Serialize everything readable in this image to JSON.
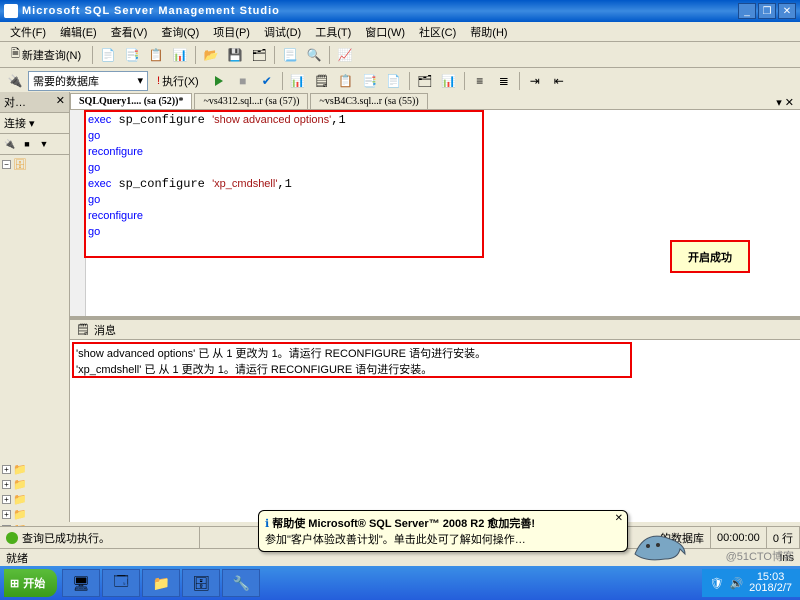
{
  "titlebar": {
    "title": "Microsoft SQL Server Management Studio"
  },
  "menubar": {
    "items": [
      "文件(F)",
      "编辑(E)",
      "查看(V)",
      "查询(Q)",
      "项目(P)",
      "调试(D)",
      "工具(T)",
      "窗口(W)",
      "社区(C)",
      "帮助(H)"
    ]
  },
  "toolbar1": {
    "new_query": "新建查询(N)"
  },
  "toolbar2": {
    "db_selected": "需要的数据库",
    "execute_label": "执行(X)"
  },
  "sidebar": {
    "title": "对…",
    "connect_label": "连接 ▾"
  },
  "tabs": [
    {
      "label": "SQLQuery1.... (sa (52))*",
      "active": true
    },
    {
      "label": "~vs4312.sql...r (sa (57))",
      "active": false
    },
    {
      "label": "~vsB4C3.sql...r (sa (55))",
      "active": false
    }
  ],
  "editor": {
    "lines": [
      {
        "t": "exec",
        "c": "blue"
      },
      {
        "t": " sp_configure ",
        "c": ""
      },
      {
        "t": "'show advanced options'",
        "c": "red"
      },
      {
        "t": ",1\n",
        "c": ""
      },
      {
        "t": "go\n",
        "c": "blue"
      },
      {
        "t": "reconfigure\n",
        "c": "blue"
      },
      {
        "t": "go\n",
        "c": "blue"
      },
      {
        "t": "exec",
        "c": "blue"
      },
      {
        "t": " sp_configure ",
        "c": ""
      },
      {
        "t": "'xp_cmdshell'",
        "c": "red"
      },
      {
        "t": ",1\n",
        "c": ""
      },
      {
        "t": "go\n",
        "c": "blue"
      },
      {
        "t": "reconfigure\n",
        "c": "blue"
      },
      {
        "t": "go\n",
        "c": "blue"
      }
    ]
  },
  "callout": {
    "text": "开启成功"
  },
  "messages": {
    "header": "消息",
    "lines": [
      "'show advanced options' 已 从 1 更改为 1。请运行 RECONFIGURE 语句进行安装。",
      "'xp_cmdshell' 已 从 1 更改为 1。请运行 RECONFIGURE 语句进行安装。"
    ]
  },
  "balloon": {
    "line1": "帮助使 Microsoft® SQL Server™ 2008 R2 愈加完善!",
    "line2": "参加\"客户体验改善计划\"。单击此处可了解如何操作…"
  },
  "statusbar": {
    "success": "查询已成功执行。",
    "db": "的数据库",
    "time": "00:00:00",
    "rows": "0 行"
  },
  "readybar": {
    "ready": "就绪",
    "ins": "Ins"
  },
  "taskbar": {
    "start": "开始",
    "clock": "15:03",
    "date": "2018/2/7",
    "watermark": "@51CTO博客"
  }
}
